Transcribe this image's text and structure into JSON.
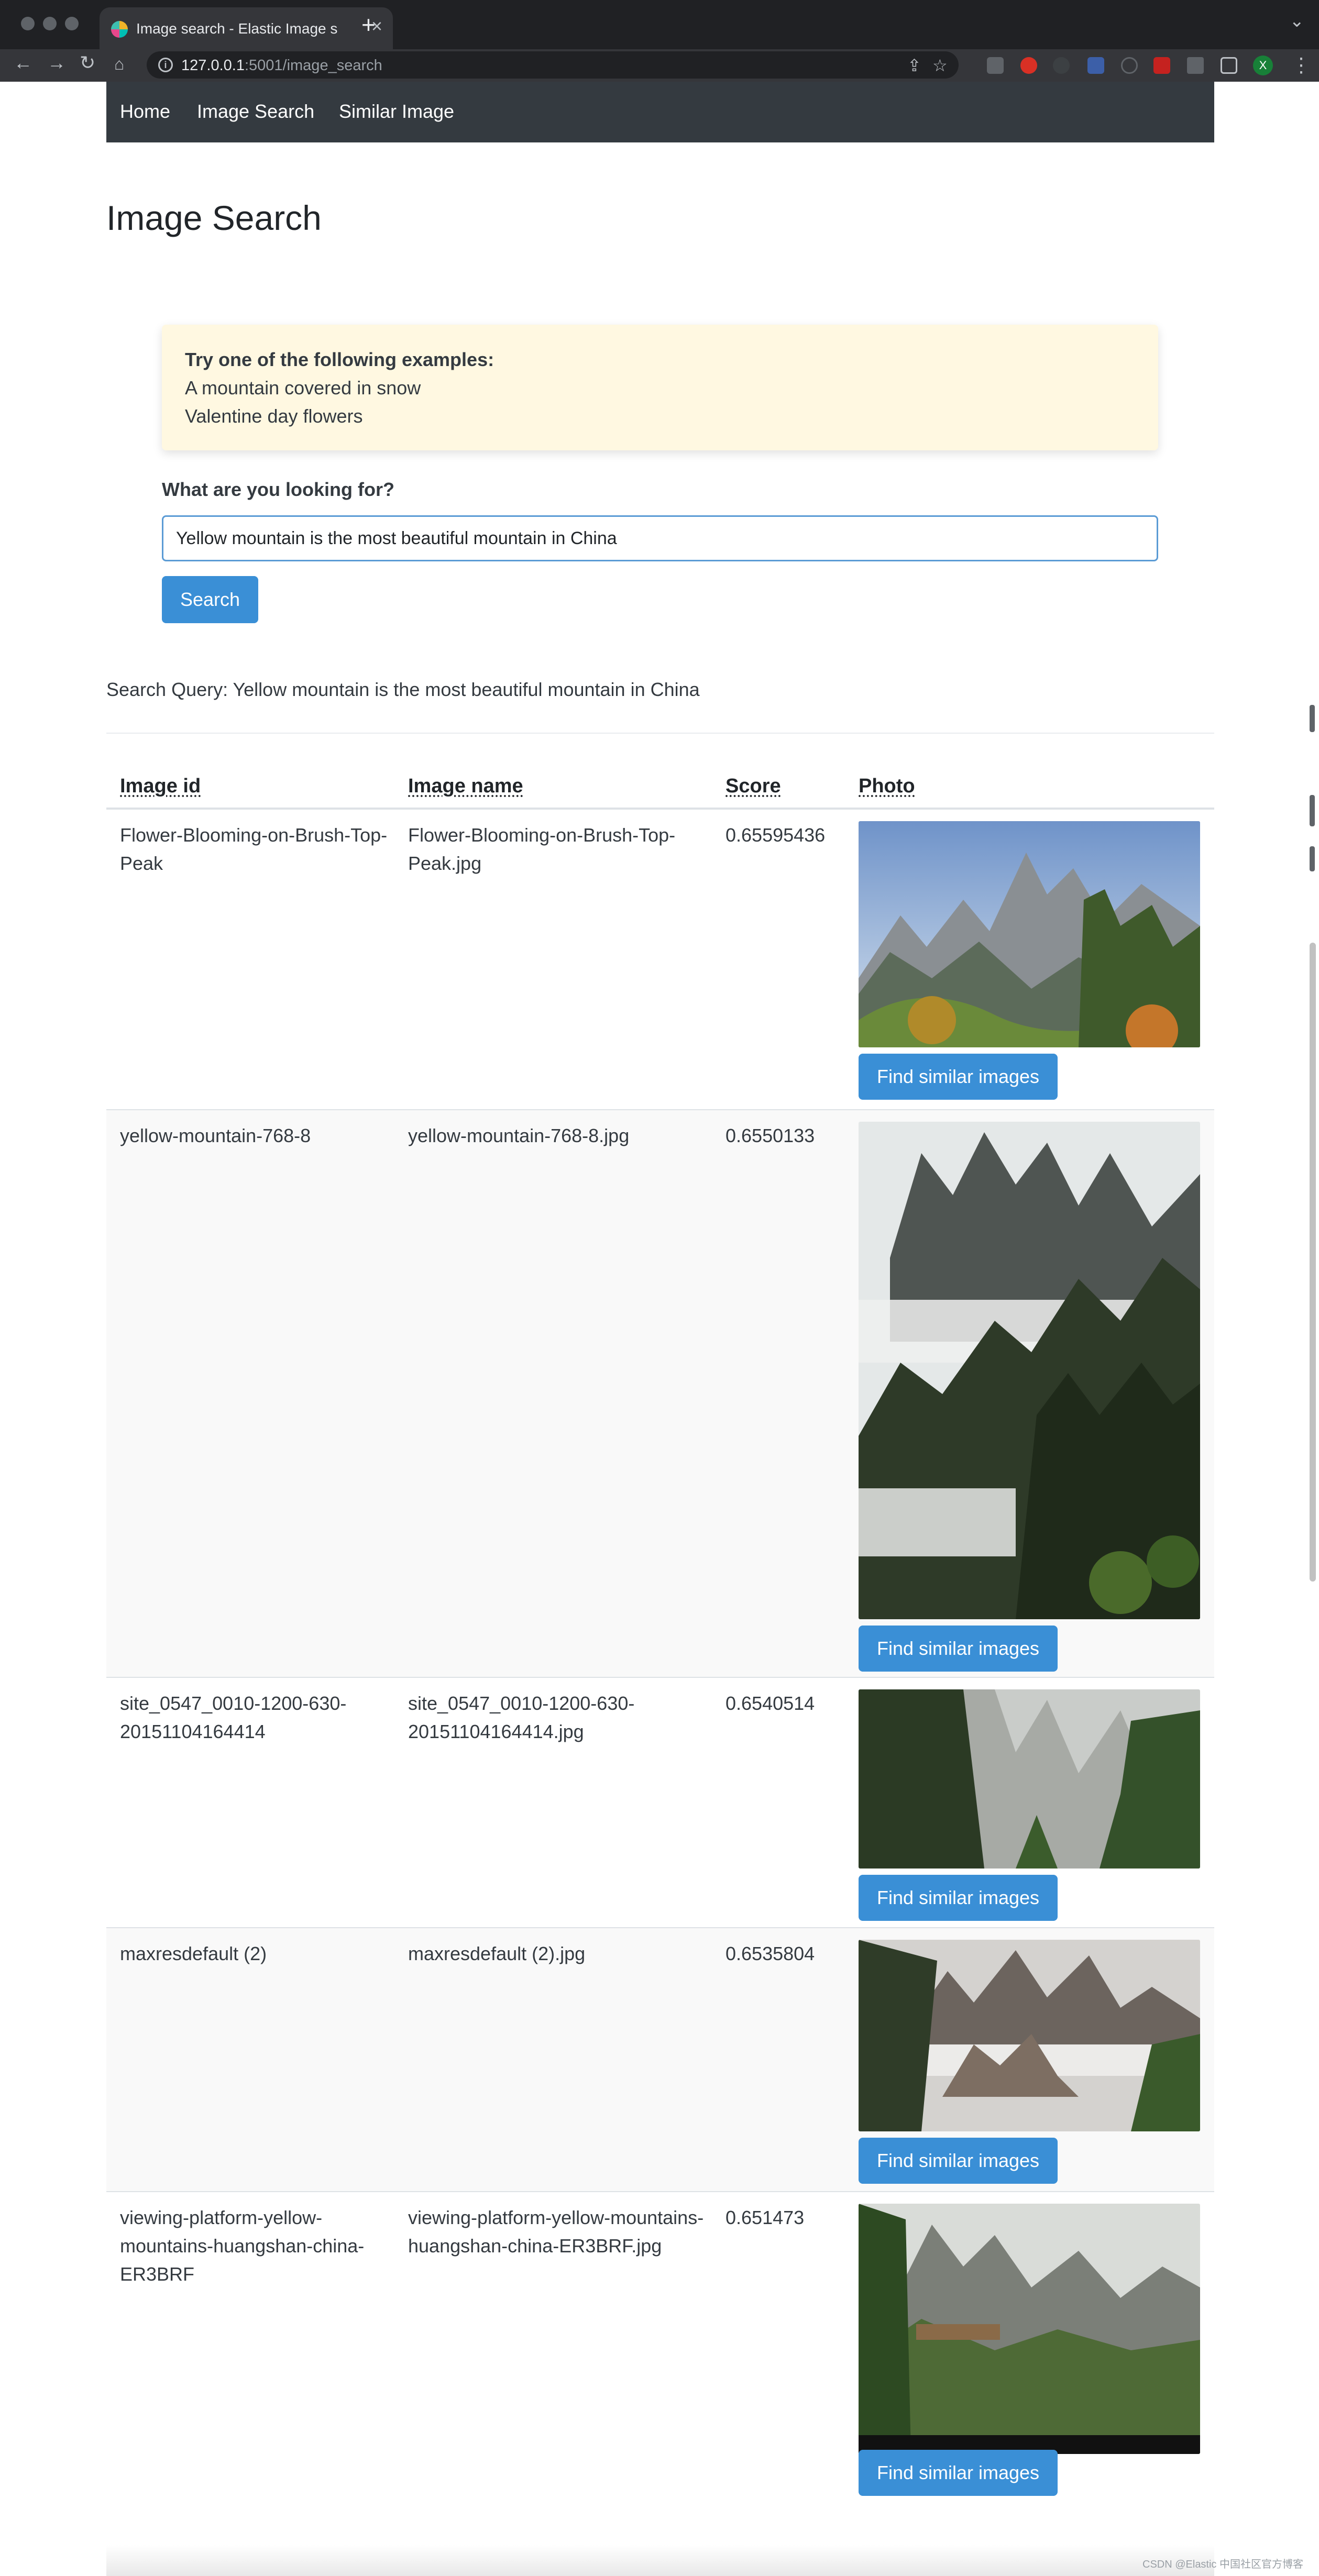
{
  "browser": {
    "tab_title": "Image search - Elastic Image s",
    "tab_close": "×",
    "new_tab": "+",
    "url_host": "127.0.0.1",
    "url_rest": ":5001/image_search"
  },
  "navbar": {
    "items": [
      "Home",
      "Image Search",
      "Similar Image"
    ]
  },
  "page": {
    "title": "Image Search"
  },
  "examples": {
    "title": "Try one of the following examples:",
    "items": [
      "A mountain covered in snow",
      "Valentine day flowers"
    ]
  },
  "search": {
    "label": "What are you looking for?",
    "value": "Yellow mountain is the most beautiful mountain in China",
    "button_label": "Search"
  },
  "query": {
    "text": "Search Query: Yellow mountain is the most beautiful mountain in China"
  },
  "table": {
    "headers": [
      "Image id",
      "Image name",
      "Score",
      "Photo"
    ],
    "button_label": "Find similar images",
    "rows": [
      {
        "id": "Flower-Blooming-on-Brush-Top-Peak",
        "name": "Flower-Blooming-on-Brush-Top-Peak.jpg",
        "score": "0.65595436"
      },
      {
        "id": "yellow-mountain-768-8",
        "name": "yellow-mountain-768-8.jpg",
        "score": "0.6550133"
      },
      {
        "id": "site_0547_0010-1200-630-20151104164414",
        "name": "site_0547_0010-1200-630-20151104164414.jpg",
        "score": "0.6540514"
      },
      {
        "id": "maxresdefault (2)",
        "name": "maxresdefault (2).jpg",
        "score": "0.6535804"
      },
      {
        "id": "viewing-platform-yellow-mountains-huangshan-china-ER3BRF",
        "name": "viewing-platform-yellow-mountains-huangshan-china-ER3BRF.jpg",
        "score": "0.651473"
      }
    ]
  },
  "footer": {
    "watermark": "CSDN @Elastic 中国社区官方博客"
  }
}
